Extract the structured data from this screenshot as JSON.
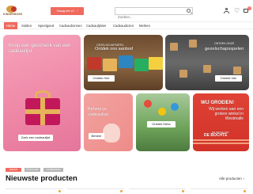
{
  "header": {
    "logo_text": "KINDERBOEK",
    "cta_label": "Vraag het u?",
    "cta_arrow": "›",
    "search_placeholder": "Zoeken...",
    "cart_count": "0"
  },
  "nav": {
    "items": [
      {
        "label": "Home",
        "active": true
      },
      {
        "label": "Solden"
      },
      {
        "label": "Speelgoed"
      },
      {
        "label": "Cadeaubonnen"
      },
      {
        "label": "Cadeaulijsten"
      },
      {
        "label": "Cadeaudozen"
      },
      {
        "label": "Merken"
      }
    ]
  },
  "tiles": {
    "gift_list": {
      "title": "Koop een geschenk van een cadeaulijst",
      "button": "Zoek een cadeaulijst"
    },
    "toys": {
      "small": "GEZELSCHAPSSPEL",
      "title": "Ontdek ons aanbod",
      "button": "Ontdek Hier"
    },
    "games": {
      "small": "ONTDEK ONZE",
      "title": "gezelschapsspelen",
      "button": "Ontdek hier"
    },
    "manage": {
      "title": "Beheer je cadeaulijst",
      "button": "Beheer"
    },
    "promo": {
      "button": "Ontdek Hebo"
    },
    "hiring": {
      "title": "WIJ GROEIEN!",
      "body": "Wij werken aan een grotere winkel in Westmalle",
      "tagline": "DE MAGIE VAN",
      "brand": "DE BOCHTE"
    }
  },
  "tags": [
    {
      "label": "NIEUW",
      "color": "#f06a5e"
    },
    {
      "label": "POPULAIR",
      "color": "#b5b5b5"
    },
    {
      "label": "AANBIEDING",
      "color": "#b5b5b5"
    }
  ],
  "section": {
    "title": "Nieuwste producten",
    "link": "Alle producten",
    "link_arrow": "›"
  }
}
